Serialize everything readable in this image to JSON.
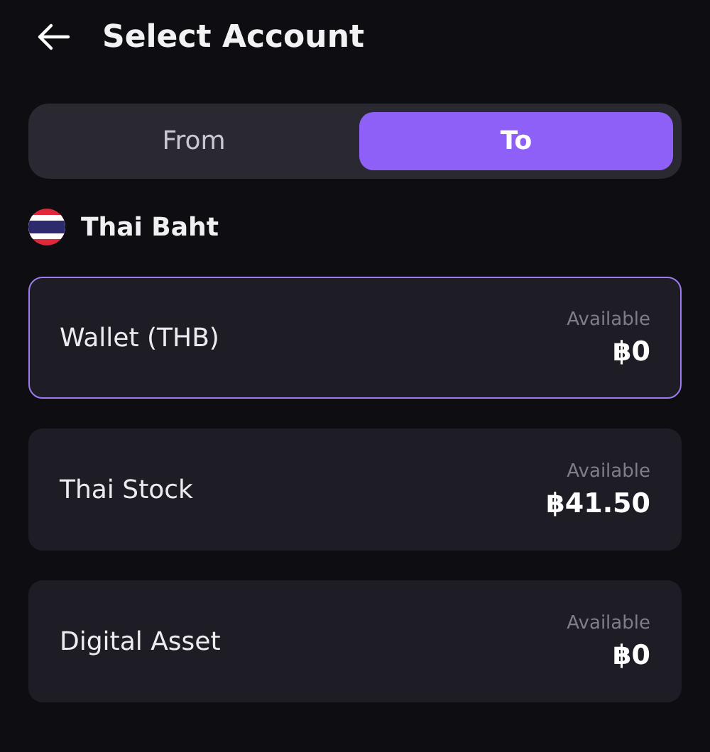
{
  "header": {
    "title": "Select Account"
  },
  "tabs": [
    {
      "label": "From",
      "selected": false
    },
    {
      "label": "To",
      "selected": true
    }
  ],
  "currency": {
    "name": "Thai Baht"
  },
  "accounts": [
    {
      "name": "Wallet (THB)",
      "caption": "Available",
      "amount": "฿0",
      "selected": true
    },
    {
      "name": "Thai Stock",
      "caption": "Available",
      "amount": "฿41.50",
      "selected": false
    },
    {
      "name": "Digital Asset",
      "caption": "Available",
      "amount": "฿0",
      "selected": false
    }
  ]
}
